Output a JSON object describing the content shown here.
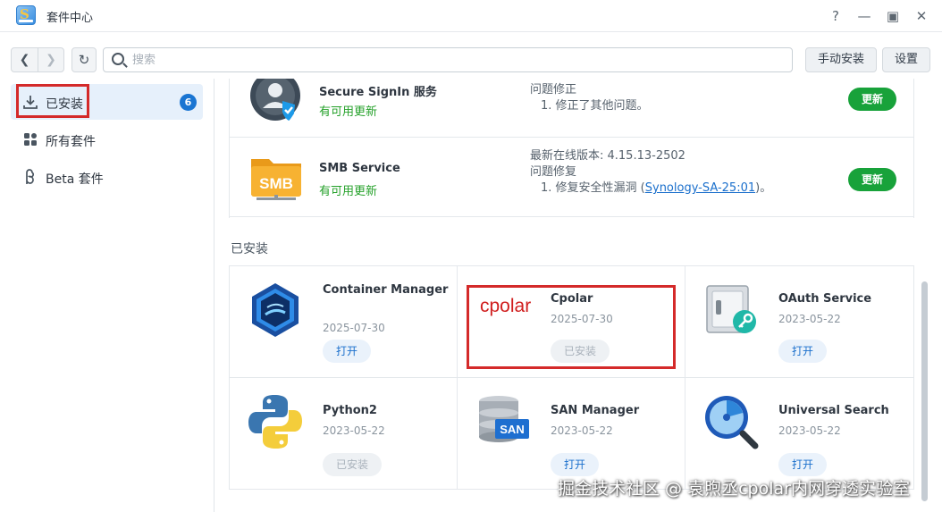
{
  "window": {
    "title": "套件中心",
    "controls": {
      "help": "?",
      "minimize": "—",
      "maximize": "▣",
      "close": "✕"
    }
  },
  "toolbar": {
    "back_icon": "chevron-left-icon",
    "forward_icon": "chevron-right-icon",
    "refresh_icon": "refresh-icon",
    "search_placeholder": "搜索",
    "manual_install_label": "手动安装",
    "settings_label": "设置"
  },
  "sidebar": {
    "items": [
      {
        "label": "已安装",
        "icon": "download-icon",
        "badge": "6",
        "active": true
      },
      {
        "label": "所有套件",
        "icon": "grid-icon",
        "active": false
      },
      {
        "label": "Beta 套件",
        "icon": "beta-icon",
        "active": false
      }
    ]
  },
  "updates": [
    {
      "name": "Secure SignIn 服务",
      "status": "有可用更新",
      "notes_heading": "问题修正",
      "notes_items": [
        "1. 修正了其他问题。"
      ],
      "button": "更新",
      "icon": "secure-signin-icon"
    },
    {
      "name": "SMB Service",
      "status": "有可用更新",
      "latest_version": "最新在线版本: 4.15.13-2502",
      "notes_heading": "问题修复",
      "notes_item_prefix": "1. 修复安全性漏洞 (",
      "notes_item_link": "Synology-SA-25:01",
      "notes_item_suffix": ")。",
      "button": "更新",
      "icon": "smb-icon",
      "icon_text": "SMB"
    }
  ],
  "installed": {
    "section_title": "已安装",
    "packages": [
      {
        "name": "Container Manager",
        "date": "2025-07-30",
        "action": "打开",
        "disabled": false,
        "icon": "container-manager-icon"
      },
      {
        "name": "Cpolar",
        "date": "2025-07-30",
        "action": "已安装",
        "disabled": true,
        "icon": "cpolar-logo",
        "logo_text": "cpolar"
      },
      {
        "name": "OAuth Service",
        "date": "2023-05-22",
        "action": "打开",
        "disabled": false,
        "icon": "oauth-safe-icon"
      },
      {
        "name": "Python2",
        "date": "2023-05-22",
        "action": "已安装",
        "disabled": true,
        "icon": "python-icon"
      },
      {
        "name": "SAN Manager",
        "date": "2023-05-22",
        "action": "打开",
        "disabled": false,
        "icon": "san-manager-icon",
        "icon_text": "SAN"
      },
      {
        "name": "Universal Search",
        "date": "2023-05-22",
        "action": "打开",
        "disabled": false,
        "icon": "universal-search-icon"
      }
    ]
  },
  "watermark": "掘金技术社区 @ 袁煦丞cpolar内网穿透实验室",
  "colors": {
    "accent_blue": "#1a75d2",
    "update_green": "#18a23a",
    "available_text": "#25a12a",
    "highlight_red": "#d42a2a"
  }
}
